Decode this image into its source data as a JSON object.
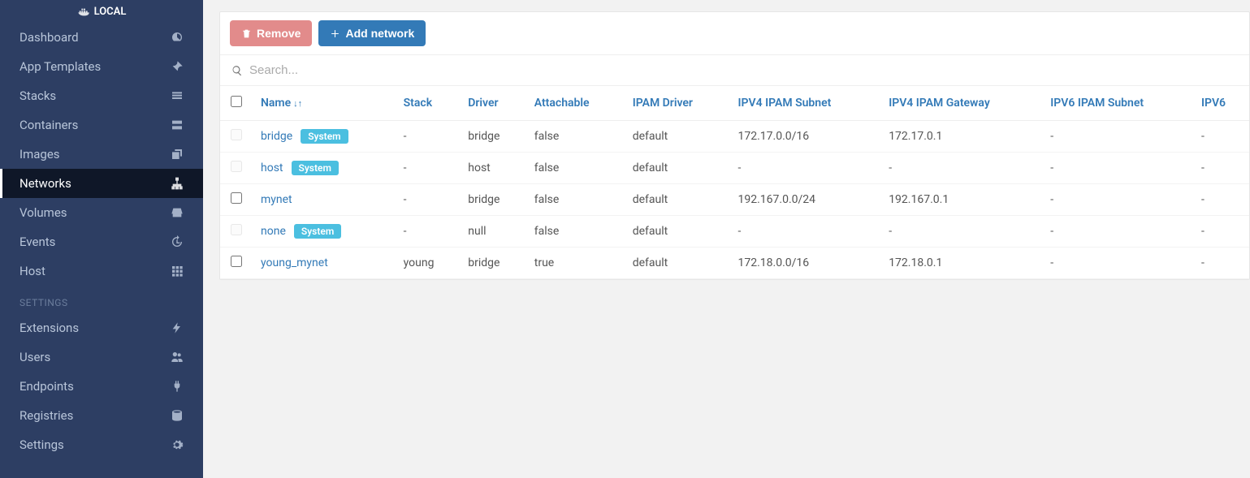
{
  "sidebar": {
    "header": "LOCAL",
    "items": [
      {
        "label": "Dashboard",
        "icon": "gauge",
        "active": false
      },
      {
        "label": "App Templates",
        "icon": "rocket",
        "active": false
      },
      {
        "label": "Stacks",
        "icon": "list",
        "active": false
      },
      {
        "label": "Containers",
        "icon": "server",
        "active": false
      },
      {
        "label": "Images",
        "icon": "clone",
        "active": false
      },
      {
        "label": "Networks",
        "icon": "sitemap",
        "active": true
      },
      {
        "label": "Volumes",
        "icon": "hdd",
        "active": false
      },
      {
        "label": "Events",
        "icon": "history",
        "active": false
      },
      {
        "label": "Host",
        "icon": "th",
        "active": false
      }
    ],
    "settings_label": "SETTINGS",
    "settings_items": [
      {
        "label": "Extensions",
        "icon": "bolt"
      },
      {
        "label": "Users",
        "icon": "users"
      },
      {
        "label": "Endpoints",
        "icon": "plug"
      },
      {
        "label": "Registries",
        "icon": "database"
      },
      {
        "label": "Settings",
        "icon": "cogs"
      }
    ]
  },
  "toolbar": {
    "remove_label": "Remove",
    "add_label": "Add network"
  },
  "search": {
    "placeholder": "Search..."
  },
  "table": {
    "columns": [
      "Name",
      "Stack",
      "Driver",
      "Attachable",
      "IPAM Driver",
      "IPV4 IPAM Subnet",
      "IPV4 IPAM Gateway",
      "IPV6 IPAM Subnet",
      "IPV6"
    ],
    "system_badge": "System",
    "rows": [
      {
        "selectable": false,
        "name": "bridge",
        "system": true,
        "stack": "-",
        "driver": "bridge",
        "attachable": "false",
        "ipam_driver": "default",
        "ipv4_subnet": "172.17.0.0/16",
        "ipv4_gateway": "172.17.0.1",
        "ipv6_subnet": "-",
        "ipv6": "-"
      },
      {
        "selectable": false,
        "name": "host",
        "system": true,
        "stack": "-",
        "driver": "host",
        "attachable": "false",
        "ipam_driver": "default",
        "ipv4_subnet": "-",
        "ipv4_gateway": "-",
        "ipv6_subnet": "-",
        "ipv6": "-"
      },
      {
        "selectable": true,
        "name": "mynet",
        "system": false,
        "stack": "-",
        "driver": "bridge",
        "attachable": "false",
        "ipam_driver": "default",
        "ipv4_subnet": "192.167.0.0/24",
        "ipv4_gateway": "192.167.0.1",
        "ipv6_subnet": "-",
        "ipv6": "-"
      },
      {
        "selectable": false,
        "name": "none",
        "system": true,
        "stack": "-",
        "driver": "null",
        "attachable": "false",
        "ipam_driver": "default",
        "ipv4_subnet": "-",
        "ipv4_gateway": "-",
        "ipv6_subnet": "-",
        "ipv6": "-"
      },
      {
        "selectable": true,
        "name": "young_mynet",
        "system": false,
        "stack": "young",
        "driver": "bridge",
        "attachable": "true",
        "ipam_driver": "default",
        "ipv4_subnet": "172.18.0.0/16",
        "ipv4_gateway": "172.18.0.1",
        "ipv6_subnet": "-",
        "ipv6": "-"
      }
    ]
  }
}
